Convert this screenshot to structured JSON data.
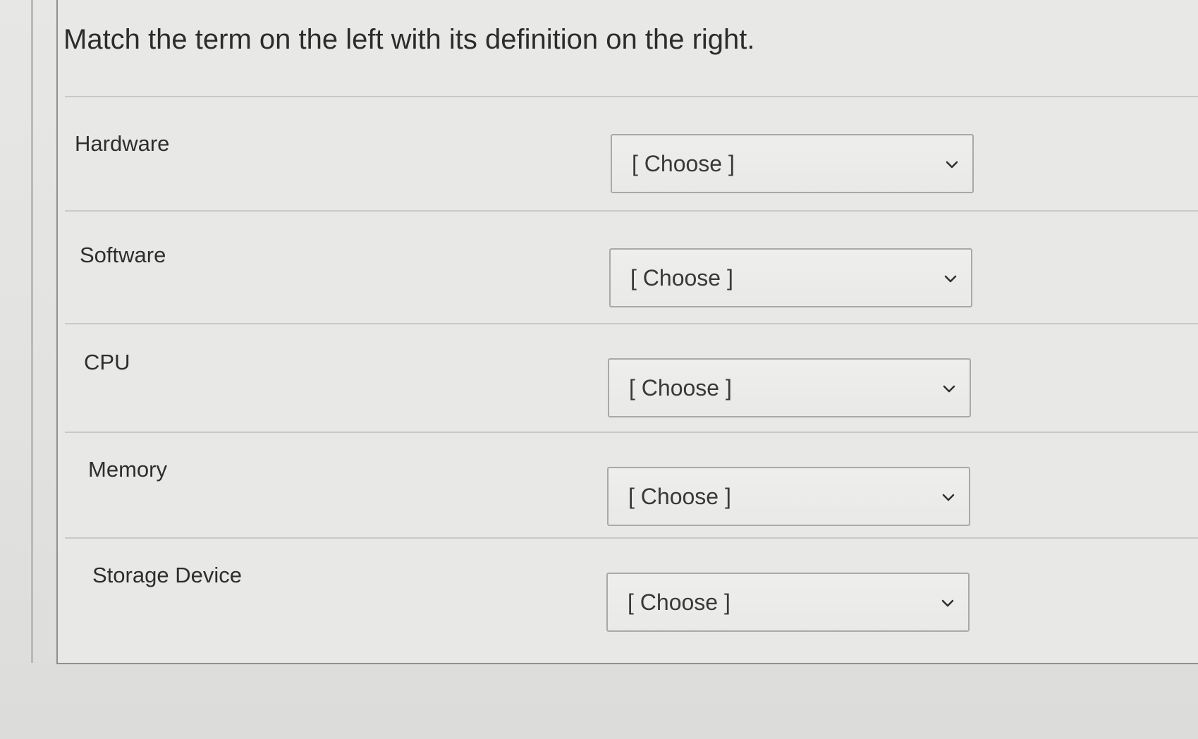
{
  "question": {
    "prompt": "Match the term on the left with its definition on the right."
  },
  "items": [
    {
      "term": "Hardware",
      "selected": "[ Choose ]"
    },
    {
      "term": "Software",
      "selected": "[ Choose ]"
    },
    {
      "term": "CPU",
      "selected": "[ Choose ]"
    },
    {
      "term": "Memory",
      "selected": "[ Choose ]"
    },
    {
      "term": "Storage Device",
      "selected": "[ Choose ]"
    }
  ],
  "icons": {
    "dropdown": "chevron-down-icon"
  },
  "colors": {
    "page_background": "#e3e3e1",
    "text": "#2e2e2e",
    "select_border": "#a9a9a7"
  }
}
